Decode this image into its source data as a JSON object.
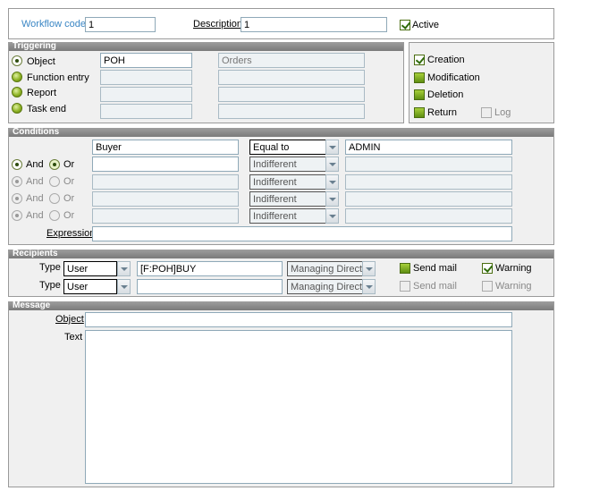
{
  "header": {
    "workflow_code_label": "Workflow code",
    "workflow_code_value": "1",
    "description_label": "Description",
    "description_value": "1",
    "active_label": "Active",
    "active_checked": true
  },
  "triggering": {
    "title": "Triggering",
    "options": [
      {
        "label": "Object",
        "selected": true,
        "value1": "POH",
        "value2": "Orders"
      },
      {
        "label": "Function entry",
        "selected": false,
        "value1": "",
        "value2": ""
      },
      {
        "label": "Report",
        "selected": false,
        "value1": "",
        "value2": ""
      },
      {
        "label": "Task end",
        "selected": false,
        "value1": "",
        "value2": ""
      }
    ],
    "events": {
      "creation": "Creation",
      "modification": "Modification",
      "deletion": "Deletion",
      "return": "Return",
      "log": "Log"
    }
  },
  "conditions": {
    "title": "Conditions",
    "and_label": "And",
    "or_label": "Or",
    "expression_label": "Expression",
    "expression_value": "",
    "rows": [
      {
        "field": "Buyer",
        "operator": "Equal to",
        "value": "ADMIN"
      },
      {
        "field": "",
        "operator": "Indifferent",
        "value": ""
      },
      {
        "field": "",
        "operator": "Indifferent",
        "value": ""
      },
      {
        "field": "",
        "operator": "Indifferent",
        "value": ""
      },
      {
        "field": "",
        "operator": "Indifferent",
        "value": ""
      }
    ]
  },
  "recipients": {
    "title": "Recipients",
    "type_label": "Type",
    "rows": [
      {
        "type": "User",
        "address": "[F:POH]BUY",
        "role": "Managing Director",
        "send_mail": "Send mail",
        "warning": "Warning",
        "warning_checked": true
      },
      {
        "type": "User",
        "address": "",
        "role": "Managing Director",
        "send_mail": "Send mail",
        "warning": "Warning",
        "warning_checked": false
      }
    ]
  },
  "message": {
    "title": "Message",
    "object_label": "Object",
    "object_value": "",
    "text_label": "Text",
    "text_value": ""
  }
}
